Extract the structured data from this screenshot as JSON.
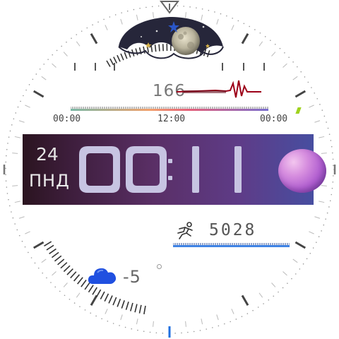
{
  "heart_rate": {
    "value": "166"
  },
  "timeline": {
    "labels": [
      "00:00",
      "12:00",
      "00:00"
    ]
  },
  "date": {
    "day": "24",
    "weekday": "ПНД"
  },
  "time": {
    "hour": "00",
    "minute": "11",
    "separator": ":"
  },
  "steps": {
    "value": "5028"
  },
  "weather": {
    "temperature": "-5",
    "icon": "cloud-icon"
  },
  "colors": {
    "accent_lime": "#9fd21f",
    "accent_red": "#c0001a",
    "accent_blue": "#1f6fe0",
    "band_start": "#2b1420",
    "band_end": "#474ea0",
    "digit_fill": "#c7c4e2"
  }
}
